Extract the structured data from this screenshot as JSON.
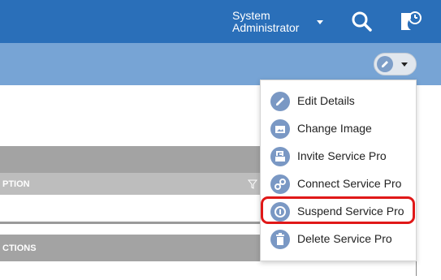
{
  "header": {
    "user_name": "System Administrator"
  },
  "table": {
    "description_header": "PTION",
    "actions_header": "CTIONS"
  },
  "action_menu": {
    "items": [
      {
        "label": "Edit Details",
        "icon": "pencil-icon"
      },
      {
        "label": "Change Image",
        "icon": "image-icon"
      },
      {
        "label": "Invite Service Pro",
        "icon": "invite-icon"
      },
      {
        "label": "Connect Service Pro",
        "icon": "link-icon"
      },
      {
        "label": "Suspend Service Pro",
        "icon": "suspend-icon",
        "highlighted": true
      },
      {
        "label": "Delete Service Pro",
        "icon": "trash-icon"
      }
    ]
  },
  "colors": {
    "header_bg": "#2a6fb9",
    "subbar_bg": "#77a4d5",
    "icon_circle": "#7a98c4",
    "highlight": "#e01818"
  }
}
